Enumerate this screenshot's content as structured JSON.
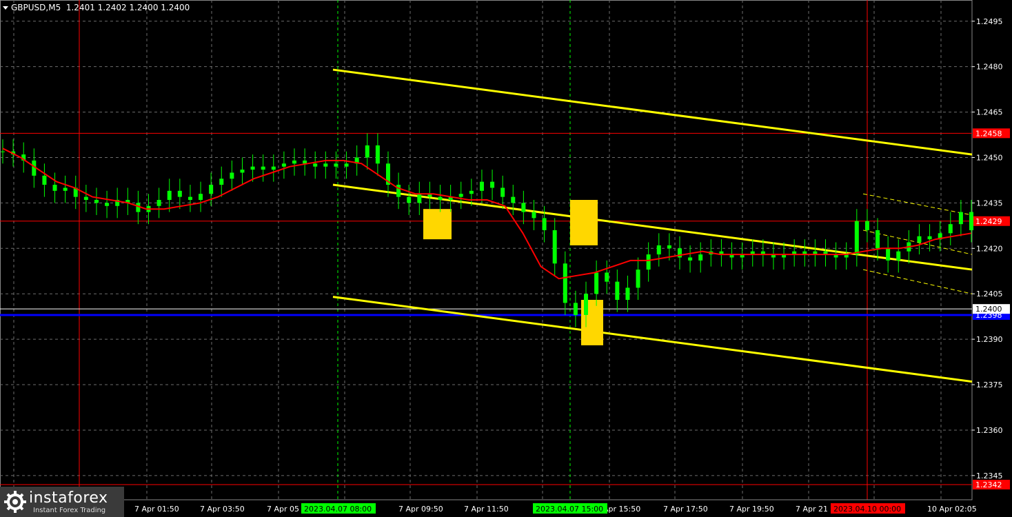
{
  "header": {
    "symbol": "GBPUSD,M5",
    "quotes": "1.2401 1.2402 1.2400 1.2400"
  },
  "logo": {
    "brand": "instaforex",
    "tagline": "Instant Forex Trading"
  },
  "colors": {
    "background": "#000000",
    "grid": "#6e6e6e",
    "candles": "#00ff00",
    "ma": "#ff0000",
    "channel": "#ffff00",
    "level_line": "#ff0000",
    "support": "#0000ff",
    "marker": "#ffd700",
    "session_line": "#00ff00"
  },
  "chart_data": {
    "type": "line",
    "symbol": "GBPUSD",
    "timeframe": "M5",
    "title": "GBPUSD,M5",
    "ylim": [
      1.2337,
      1.2502
    ],
    "y_ticks": [
      "1.2495",
      "1.2480",
      "1.2465",
      "1.2450",
      "1.2435",
      "1.2420",
      "1.2405",
      "1.2390",
      "1.2375",
      "1.2360",
      "1.2345"
    ],
    "x_ticks": [
      "7 Apr 01:50",
      "7 Apr 03:50",
      "7 Apr 05",
      "7 Apr 09:50",
      "7 Apr 11:50",
      "Apr 15:50",
      "7 Apr 17:50",
      "7 Apr 19:50",
      "7 Apr 21",
      "10 Apr 02:05"
    ],
    "x_highlight_labels": [
      {
        "label": "2023.04.07 08:00",
        "color": "#00ff00"
      },
      {
        "label": "2023.04.07 15:00",
        "color": "#00ff00"
      },
      {
        "label": "2023.04.10 00:00",
        "color": "#ff0000"
      }
    ],
    "horizontal_levels": [
      {
        "label": "1.2458",
        "value": 1.2458,
        "color": "#ff0000"
      },
      {
        "label": "1.2429",
        "value": 1.2429,
        "color": "#ff0000"
      },
      {
        "label": "1.2342",
        "value": 1.2342,
        "color": "#ff0000"
      },
      {
        "label": "1.2398",
        "value": 1.2398,
        "color": "#0000ff"
      },
      {
        "label": "1.2400",
        "value": 1.24,
        "color": "#ffffff"
      }
    ],
    "price_series": {
      "name": "",
      "values": [
        1.2452,
        1.2451,
        1.2449,
        1.2444,
        1.2441,
        1.2439,
        1.244,
        1.2437,
        1.2436,
        1.2435,
        1.2434,
        1.2436,
        1.2435,
        1.2432,
        1.2434,
        1.2436,
        1.2439,
        1.2437,
        1.2436,
        1.2438,
        1.2441,
        1.2443,
        1.2445,
        1.2446,
        1.2447,
        1.2446,
        1.2447,
        1.2448,
        1.2449,
        1.2448,
        1.2447,
        1.2448,
        1.2447,
        1.2448,
        1.245,
        1.2454,
        1.2448,
        1.2441,
        1.2437,
        1.2435,
        1.2438,
        1.2437,
        1.2436,
        1.2437,
        1.2438,
        1.2439,
        1.2442,
        1.244,
        1.2437,
        1.2435,
        1.2432,
        1.243,
        1.2426,
        1.2415,
        1.2402,
        1.2398,
        1.2405,
        1.2412,
        1.2409,
        1.2403,
        1.2407,
        1.2413,
        1.2418,
        1.2421,
        1.242,
        1.2417,
        1.2416,
        1.2418,
        1.2419,
        1.2418,
        1.2417,
        1.2418,
        1.2419,
        1.2418,
        1.2417,
        1.2418,
        1.2419,
        1.2418,
        1.2419,
        1.2418,
        1.2417,
        1.2418,
        1.2429,
        1.2426,
        1.242,
        1.2416,
        1.2419,
        1.2422,
        1.2424,
        1.2423,
        1.2425,
        1.2428,
        1.2432,
        1.2426
      ]
    },
    "ma_series": {
      "name": "",
      "values": [
        1.2453,
        1.245,
        1.2446,
        1.2442,
        1.244,
        1.2437,
        1.2436,
        1.2435,
        1.2433,
        1.2433,
        1.2434,
        1.2435,
        1.2437,
        1.244,
        1.2443,
        1.2445,
        1.2447,
        1.2448,
        1.2449,
        1.2449,
        1.2448,
        1.2444,
        1.244,
        1.2438,
        1.2438,
        1.2437,
        1.2436,
        1.2436,
        1.2434,
        1.2425,
        1.2414,
        1.241,
        1.2411,
        1.2412,
        1.2414,
        1.2416,
        1.2416,
        1.2417,
        1.2418,
        1.2419,
        1.2418,
        1.2418,
        1.2418,
        1.2418,
        1.2418,
        1.2418,
        1.2418,
        1.2418,
        1.2419,
        1.242,
        1.242,
        1.2421,
        1.2423,
        1.2424,
        1.2425
      ]
    },
    "channel_lines": [
      {
        "name": "",
        "start": 1.2479,
        "end": 1.2451
      },
      {
        "name": "",
        "start": 1.2441,
        "end": 1.2413
      },
      {
        "name": "",
        "start": 1.2404,
        "end": 1.2376
      }
    ],
    "dashed_channel": [
      {
        "start": 1.2438,
        "end": 1.2431
      },
      {
        "start": 1.2426,
        "end": 1.2418
      },
      {
        "start": 1.2413,
        "end": 1.2405
      }
    ],
    "markers": [
      {
        "name": "signal-1",
        "low": 1.2423,
        "high": 1.2433
      },
      {
        "name": "signal-2",
        "low": 1.2421,
        "high": 1.2436
      },
      {
        "name": "signal-3",
        "low": 1.2388,
        "high": 1.2403
      }
    ]
  }
}
